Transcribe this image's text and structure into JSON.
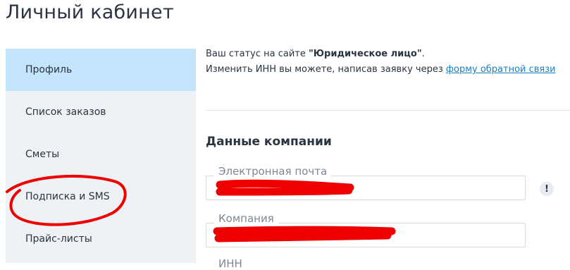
{
  "page": {
    "title": "Личный кабинет"
  },
  "sidebar": {
    "items": [
      {
        "label": "Профиль",
        "active": true
      },
      {
        "label": "Список заказов"
      },
      {
        "label": "Сметы"
      },
      {
        "label": "Подписка и SMS",
        "annotated": true
      },
      {
        "label": "Прайс-листы"
      }
    ]
  },
  "status": {
    "prefix": "Ваш статус на сайте ",
    "value": "\"Юридическое лицо\"",
    "suffix": ".",
    "inn_text": "Изменить ИНН вы можете, написав заявку через ",
    "feedback_link": "форму обратной связи"
  },
  "company_section": {
    "title": "Данные компании",
    "fields": [
      {
        "label": "Электронная почта",
        "value": ""
      },
      {
        "label": "Компания",
        "value": ""
      },
      {
        "label": "ИНН"
      }
    ]
  },
  "icons": {
    "email_warning": "exclamation-icon"
  },
  "colors": {
    "active_item_bg": "#c3e4fa",
    "sidebar_bg": "#eef2f5",
    "link": "#1a7fc1",
    "annotation_red": "#ee0000"
  }
}
